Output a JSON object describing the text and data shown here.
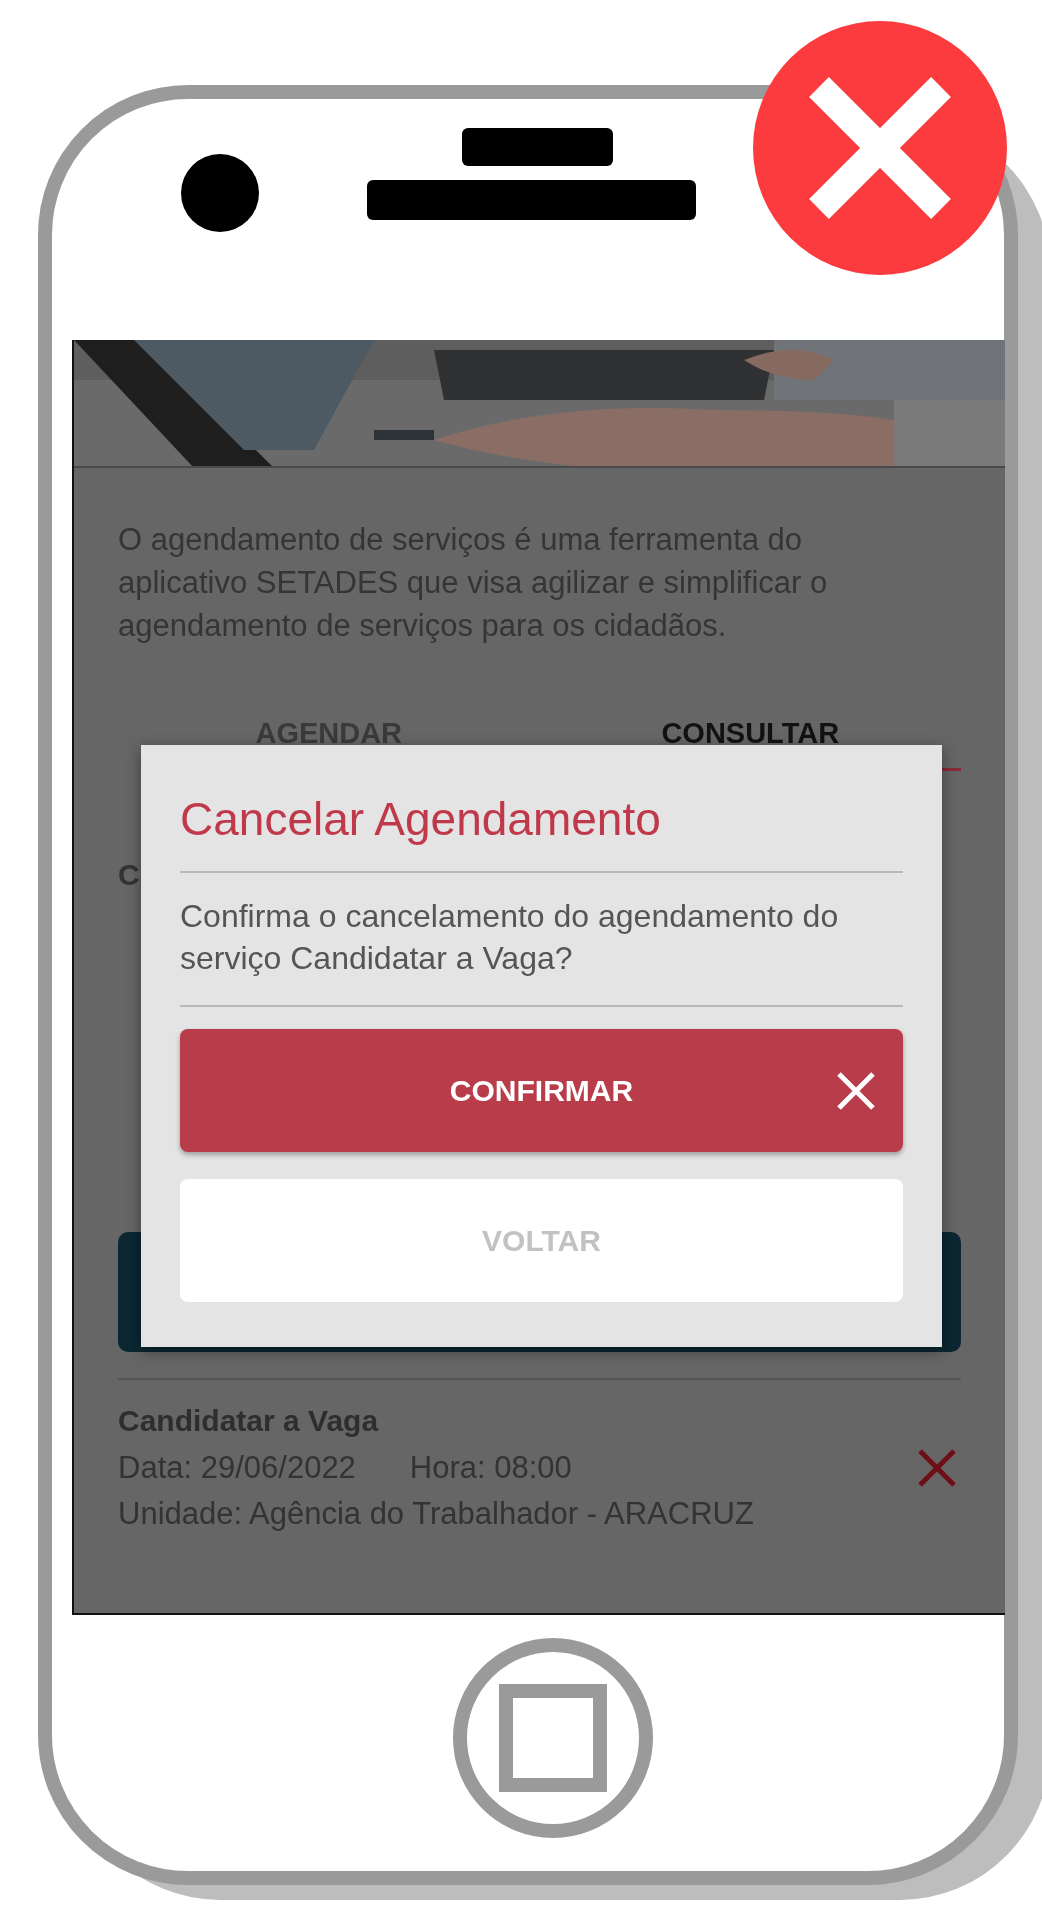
{
  "intro": "O agendamento de serviços é uma ferramenta do aplicativo SETADES que visa agilizar e simplificar o agendamento de serviços para os cidadãos.",
  "tabs": [
    {
      "label": "AGENDAR",
      "selected": false
    },
    {
      "label": "CONSULTAR",
      "selected": true
    }
  ],
  "section_label": "C",
  "appointments": [
    {
      "service": "Candidatar a Vaga",
      "date": "Data: 29/06/2022",
      "time": "Hora: 08:00",
      "unit": "Unidade: Agência do Trabalhador - ARACRUZ"
    }
  ],
  "dialog": {
    "title": "Cancelar Agendamento",
    "message": "Confirma o cancelamento do agendamento do serviço Candidatar a Vaga?",
    "buttons": [
      {
        "label": "CONFIRMAR",
        "kind": "primary"
      },
      {
        "label": "VOLTAR",
        "kind": "secondary"
      }
    ]
  }
}
